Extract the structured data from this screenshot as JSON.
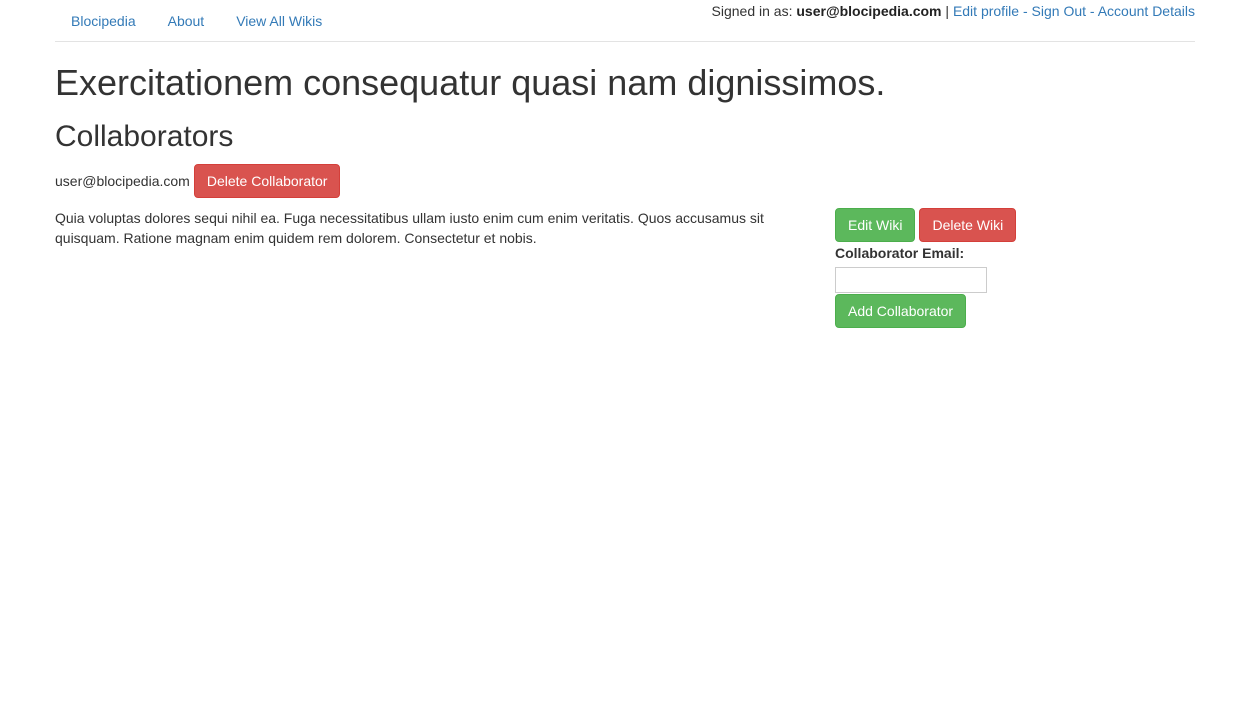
{
  "nav": {
    "links": [
      "Blocipedia",
      "About",
      "View All Wikis"
    ]
  },
  "user_bar": {
    "signed_in_prefix": "Signed in as:",
    "email": "user@blocipedia.com",
    "separator_pipe": "|",
    "edit_profile": "Edit profile",
    "dash1": "-",
    "sign_out": "Sign Out",
    "dash2": "-",
    "account_details": "Account Details"
  },
  "wiki": {
    "title": "Exercitationem consequatur quasi nam dignissimos.",
    "body": "Quia voluptas dolores sequi nihil ea. Fuga necessitatibus ullam iusto enim cum enim veritatis. Quos accusamus sit quisquam. Ratione magnam enim quidem rem dolorem. Consectetur et nobis."
  },
  "collaborators": {
    "heading": "Collaborators",
    "items": [
      {
        "email": "user@blocipedia.com",
        "delete_label": "Delete Collaborator"
      }
    ]
  },
  "sidebar": {
    "edit_label": "Edit Wiki",
    "delete_label": "Delete Wiki",
    "email_label": "Collaborator Email:",
    "email_value": "",
    "add_label": "Add Collaborator"
  },
  "colors": {
    "link": "#337ab7",
    "danger": "#d9534f",
    "success": "#5cb85c"
  }
}
